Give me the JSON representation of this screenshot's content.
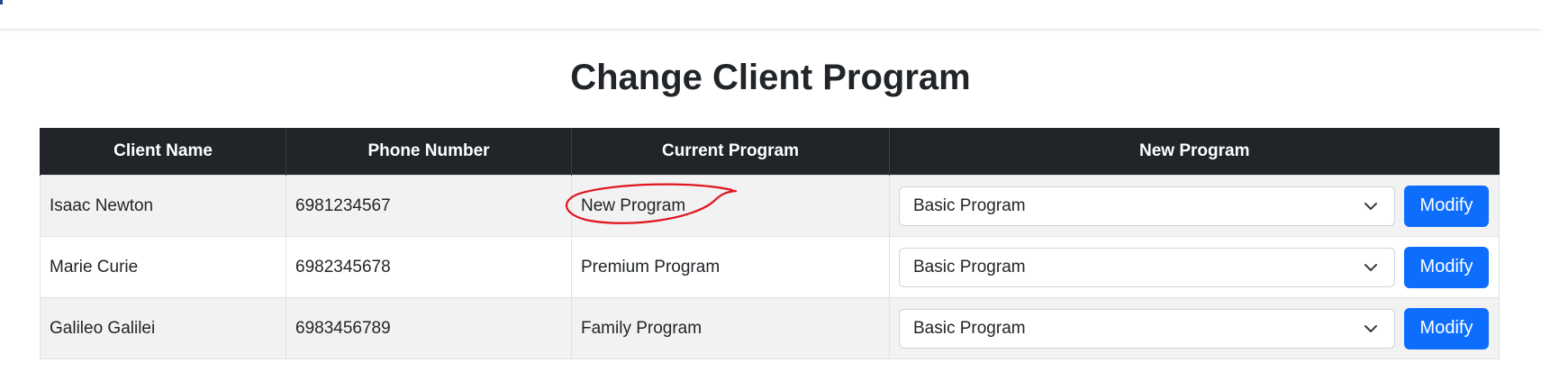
{
  "page": {
    "title": "Change Client Program"
  },
  "table": {
    "headers": [
      "Client Name",
      "Phone Number",
      "Current Program",
      "New Program"
    ],
    "rows": [
      {
        "client_name": "Isaac Newton",
        "phone": "6981234567",
        "current_program": "New Program",
        "selected_program": "Basic Program",
        "button_label": "Modify",
        "highlighted": true
      },
      {
        "client_name": "Marie Curie",
        "phone": "6982345678",
        "current_program": "Premium Program",
        "selected_program": "Basic Program",
        "button_label": "Modify",
        "highlighted": false
      },
      {
        "client_name": "Galileo Galilei",
        "phone": "6983456789",
        "current_program": "Family Program",
        "selected_program": "Basic Program",
        "button_label": "Modify",
        "highlighted": false
      }
    ]
  },
  "colors": {
    "header_bg": "#212529",
    "button_bg": "#0d6efd",
    "annotation_ring": "#e0141e",
    "stripe_bg": "#f2f2f2"
  },
  "icons": {
    "select_arrow": "chevron-down-icon"
  }
}
